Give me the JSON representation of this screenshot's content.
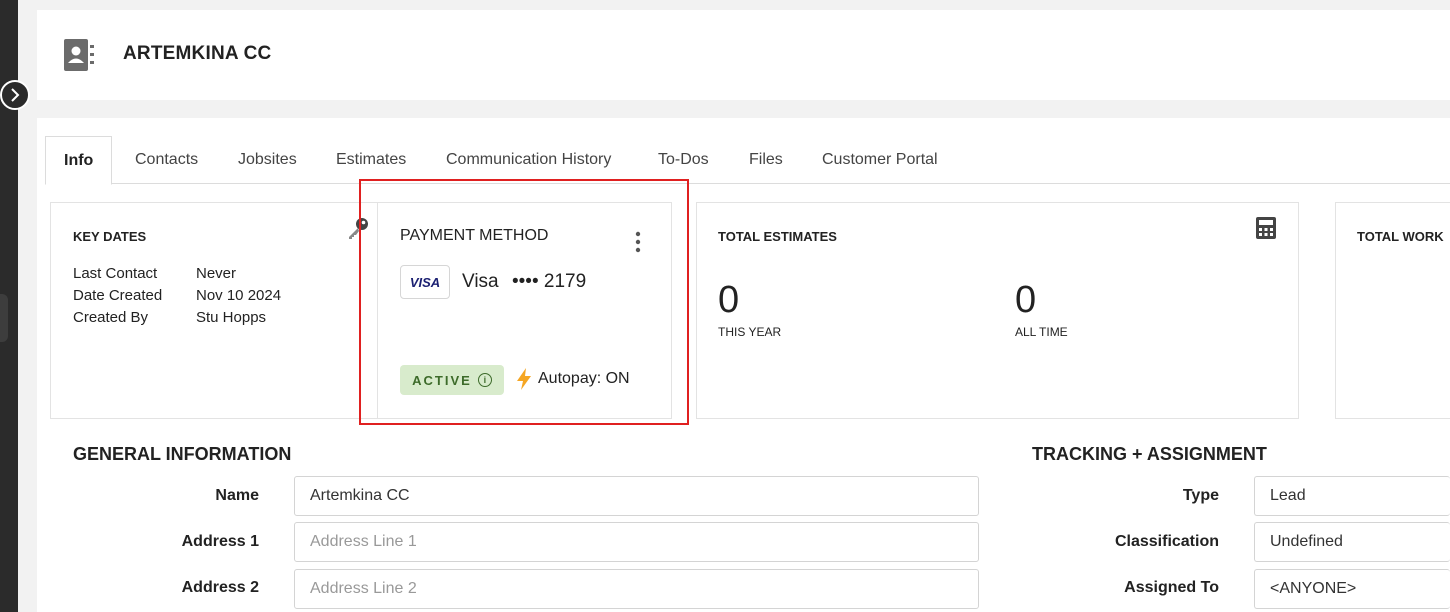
{
  "customer": {
    "name": "ARTEMKINA CC"
  },
  "tabs": [
    {
      "label": "Info"
    },
    {
      "label": "Contacts"
    },
    {
      "label": "Jobsites"
    },
    {
      "label": "Estimates"
    },
    {
      "label": "Communication History"
    },
    {
      "label": "To-Dos"
    },
    {
      "label": "Files"
    },
    {
      "label": "Customer Portal"
    }
  ],
  "key_dates": {
    "title": "KEY DATES",
    "rows": [
      {
        "label": "Last Contact",
        "value": "Never"
      },
      {
        "label": "Date Created",
        "value": "Nov 10 2024"
      },
      {
        "label": "Created By",
        "value": "Stu Hopps"
      }
    ]
  },
  "payment_method": {
    "title": "PAYMENT METHOD",
    "brand_badge": "VISA",
    "brand": "Visa",
    "masked_number": "•••• 2179",
    "status": "ACTIVE",
    "autopay": "Autopay: ON"
  },
  "total_estimates": {
    "title": "TOTAL ESTIMATES",
    "this_year_value": "0",
    "this_year_label": "THIS YEAR",
    "all_time_value": "0",
    "all_time_label": "ALL TIME"
  },
  "total_work": {
    "title": "TOTAL WORK"
  },
  "general_info": {
    "title": "GENERAL INFORMATION",
    "name_label": "Name",
    "name_value": "Artemkina CC",
    "address1_label": "Address 1",
    "address1_placeholder": "Address Line 1",
    "address2_label": "Address 2",
    "address2_placeholder": "Address Line 2"
  },
  "tracking": {
    "title": "TRACKING + ASSIGNMENT",
    "type_label": "Type",
    "type_value": "Lead",
    "classification_label": "Classification",
    "classification_value": "Undefined",
    "assigned_label": "Assigned To",
    "assigned_value": "<ANYONE>"
  },
  "colors": {
    "highlight": "#e02020",
    "active_badge_bg": "#d8ebcc",
    "active_badge_text": "#3d6b2a",
    "autopay_bolt": "#f5a623",
    "visa_blue": "#1a1f71"
  }
}
